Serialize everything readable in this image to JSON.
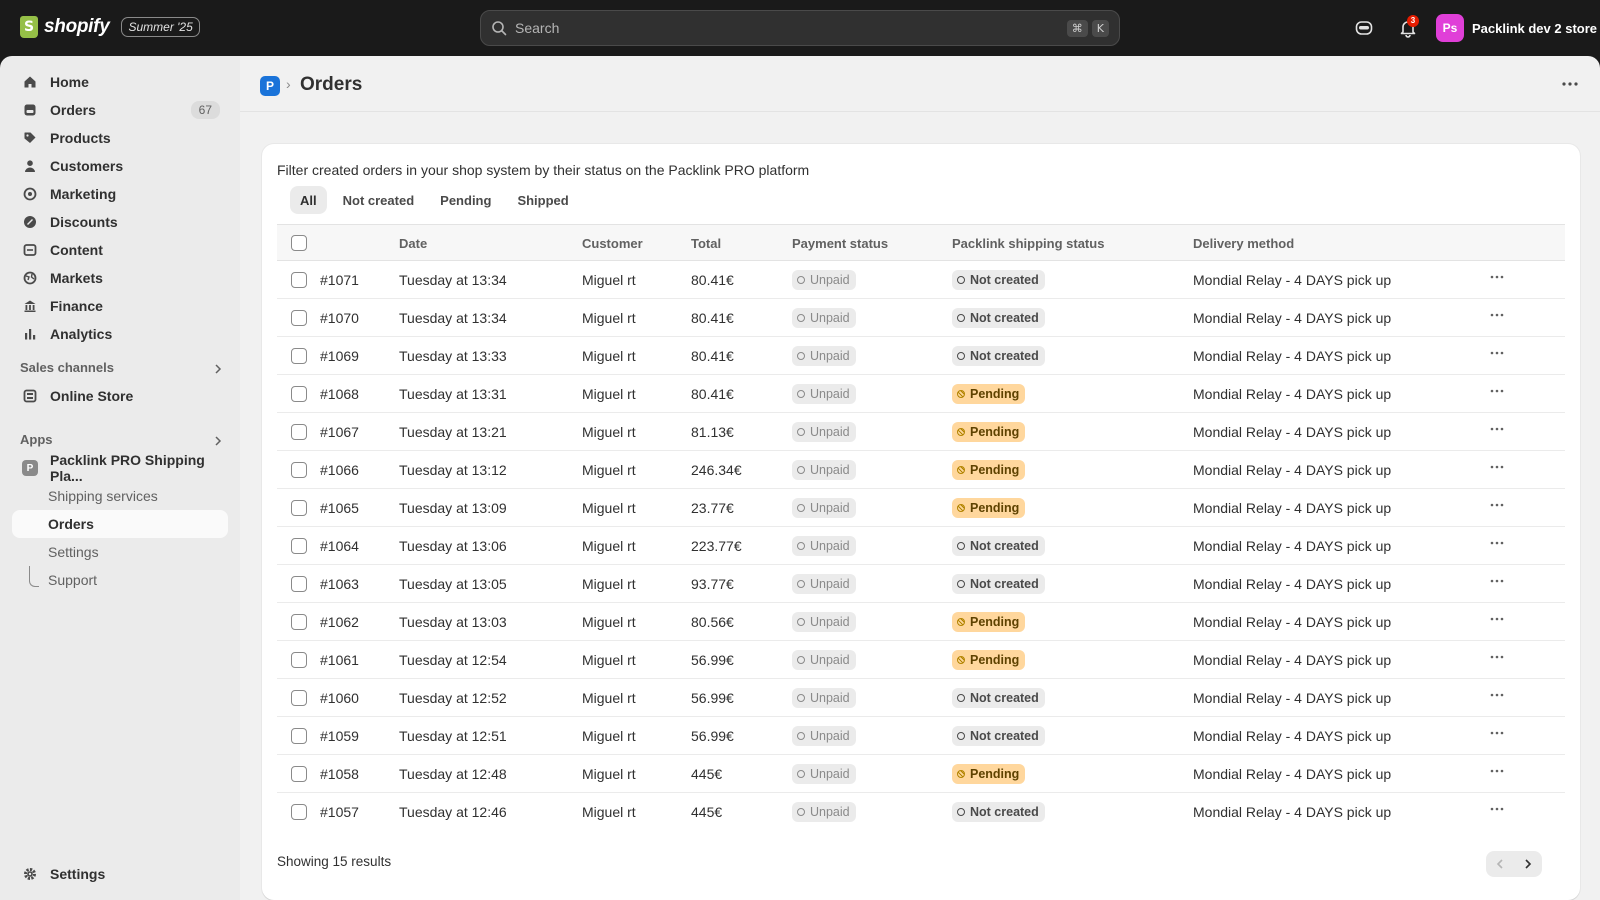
{
  "topbar": {
    "brand": "shopify",
    "edition": "Summer '25",
    "search_placeholder": "Search",
    "shortcut_keys": [
      "⌘",
      "K"
    ],
    "notifications_count": "3",
    "store_initials": "Ps",
    "store_name": "Packlink dev 2 store",
    "store_avatar_color": "#e03fd8"
  },
  "sidebar": {
    "items": [
      {
        "label": "Home",
        "icon": "home-icon"
      },
      {
        "label": "Orders",
        "icon": "orders-icon",
        "count": "67"
      },
      {
        "label": "Products",
        "icon": "tag-icon"
      },
      {
        "label": "Customers",
        "icon": "person-icon"
      },
      {
        "label": "Marketing",
        "icon": "target-icon"
      },
      {
        "label": "Discounts",
        "icon": "discount-icon"
      },
      {
        "label": "Content",
        "icon": "content-icon"
      },
      {
        "label": "Markets",
        "icon": "globe-icon"
      },
      {
        "label": "Finance",
        "icon": "bank-icon"
      },
      {
        "label": "Analytics",
        "icon": "bar-chart-icon"
      }
    ],
    "sales_channels_title": "Sales channels",
    "online_store": "Online Store",
    "apps_title": "Apps",
    "app_name": "Packlink PRO Shipping Pla...",
    "app_initial": "P",
    "app_sub_items": [
      "Shipping services",
      "Orders",
      "Settings",
      "Support"
    ],
    "settings_label": "Settings"
  },
  "page": {
    "app_badge": "P",
    "separator": "›",
    "title": "Orders",
    "description": "Filter created orders in your shop system by their status on the Packlink PRO platform",
    "tabs": [
      "All",
      "Not created",
      "Pending",
      "Shipped"
    ],
    "active_tab": "All",
    "columns": [
      "Date",
      "Customer",
      "Total",
      "Payment status",
      "Packlink shipping status",
      "Delivery method"
    ],
    "results_text": "Showing 15 results",
    "orders": [
      {
        "id": "#1071",
        "date": "Tuesday at 13:34",
        "customer": "Miguel rt",
        "total": "80.41€",
        "payment": "Unpaid",
        "shipping": "Not created",
        "delivery": "Mondial Relay - 4 DAYS pick up"
      },
      {
        "id": "#1070",
        "date": "Tuesday at 13:34",
        "customer": "Miguel rt",
        "total": "80.41€",
        "payment": "Unpaid",
        "shipping": "Not created",
        "delivery": "Mondial Relay - 4 DAYS pick up"
      },
      {
        "id": "#1069",
        "date": "Tuesday at 13:33",
        "customer": "Miguel rt",
        "total": "80.41€",
        "payment": "Unpaid",
        "shipping": "Not created",
        "delivery": "Mondial Relay - 4 DAYS pick up"
      },
      {
        "id": "#1068",
        "date": "Tuesday at 13:31",
        "customer": "Miguel rt",
        "total": "80.41€",
        "payment": "Unpaid",
        "shipping": "Pending",
        "delivery": "Mondial Relay - 4 DAYS pick up"
      },
      {
        "id": "#1067",
        "date": "Tuesday at 13:21",
        "customer": "Miguel rt",
        "total": "81.13€",
        "payment": "Unpaid",
        "shipping": "Pending",
        "delivery": "Mondial Relay - 4 DAYS pick up"
      },
      {
        "id": "#1066",
        "date": "Tuesday at 13:12",
        "customer": "Miguel rt",
        "total": "246.34€",
        "payment": "Unpaid",
        "shipping": "Pending",
        "delivery": "Mondial Relay - 4 DAYS pick up"
      },
      {
        "id": "#1065",
        "date": "Tuesday at 13:09",
        "customer": "Miguel rt",
        "total": "23.77€",
        "payment": "Unpaid",
        "shipping": "Pending",
        "delivery": "Mondial Relay - 4 DAYS pick up"
      },
      {
        "id": "#1064",
        "date": "Tuesday at 13:06",
        "customer": "Miguel rt",
        "total": "223.77€",
        "payment": "Unpaid",
        "shipping": "Not created",
        "delivery": "Mondial Relay - 4 DAYS pick up"
      },
      {
        "id": "#1063",
        "date": "Tuesday at 13:05",
        "customer": "Miguel rt",
        "total": "93.77€",
        "payment": "Unpaid",
        "shipping": "Not created",
        "delivery": "Mondial Relay - 4 DAYS pick up"
      },
      {
        "id": "#1062",
        "date": "Tuesday at 13:03",
        "customer": "Miguel rt",
        "total": "80.56€",
        "payment": "Unpaid",
        "shipping": "Pending",
        "delivery": "Mondial Relay - 4 DAYS pick up"
      },
      {
        "id": "#1061",
        "date": "Tuesday at 12:54",
        "customer": "Miguel rt",
        "total": "56.99€",
        "payment": "Unpaid",
        "shipping": "Pending",
        "delivery": "Mondial Relay - 4 DAYS pick up"
      },
      {
        "id": "#1060",
        "date": "Tuesday at 12:52",
        "customer": "Miguel rt",
        "total": "56.99€",
        "payment": "Unpaid",
        "shipping": "Not created",
        "delivery": "Mondial Relay - 4 DAYS pick up"
      },
      {
        "id": "#1059",
        "date": "Tuesday at 12:51",
        "customer": "Miguel rt",
        "total": "56.99€",
        "payment": "Unpaid",
        "shipping": "Not created",
        "delivery": "Mondial Relay - 4 DAYS pick up"
      },
      {
        "id": "#1058",
        "date": "Tuesday at 12:48",
        "customer": "Miguel rt",
        "total": "445€",
        "payment": "Unpaid",
        "shipping": "Pending",
        "delivery": "Mondial Relay - 4 DAYS pick up"
      },
      {
        "id": "#1057",
        "date": "Tuesday at 12:46",
        "customer": "Miguel rt",
        "total": "445€",
        "payment": "Unpaid",
        "shipping": "Not created",
        "delivery": "Mondial Relay - 4 DAYS pick up"
      }
    ]
  },
  "colors": {
    "topbar_bg": "#1a1a1a",
    "sidebar_bg": "#ebebeb",
    "main_bg": "#f1f1f1",
    "pending_badge": "#ffd79d",
    "neutral_badge": "#ebebeb",
    "app_badge": "#1a73d9"
  }
}
